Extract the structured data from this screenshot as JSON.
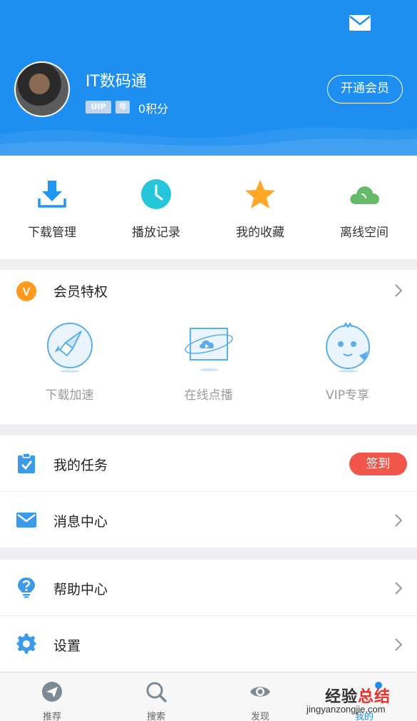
{
  "profile": {
    "username": "IT数码通",
    "badge_vip": "UIP",
    "badge_year": "年",
    "points": "0积分",
    "member_button": "开通会员"
  },
  "quick_actions": [
    {
      "label": "下载管理",
      "icon": "download-icon",
      "color": "#2196f3"
    },
    {
      "label": "播放记录",
      "icon": "clock-icon",
      "color": "#26c6da"
    },
    {
      "label": "我的收藏",
      "icon": "star-icon",
      "color": "#ffa726"
    },
    {
      "label": "离线空间",
      "icon": "cloud-icon",
      "color": "#66bb6a"
    }
  ],
  "vip_section": {
    "title": "会员特权",
    "badge_letter": "V",
    "perks": [
      {
        "label": "下载加速",
        "icon": "rocket-icon"
      },
      {
        "label": "在线点播",
        "icon": "video-play-icon"
      },
      {
        "label": "VIP专享",
        "icon": "mascot-icon"
      }
    ]
  },
  "menu_group_1": [
    {
      "label": "我的任务",
      "icon": "clipboard-check-icon",
      "action_label": "签到"
    },
    {
      "label": "消息中心",
      "icon": "envelope-icon"
    }
  ],
  "menu_group_2": [
    {
      "label": "帮助中心",
      "icon": "help-bulb-icon"
    },
    {
      "label": "设置",
      "icon": "gear-icon"
    }
  ],
  "tabbar": [
    {
      "label": "推荐",
      "icon": "paper-plane-icon",
      "active": false
    },
    {
      "label": "搜索",
      "icon": "search-icon",
      "active": false
    },
    {
      "label": "发现",
      "icon": "eye-icon",
      "active": false
    },
    {
      "label": "我的",
      "icon": "user-icon",
      "active": true
    }
  ],
  "watermark": {
    "text_a": "经验",
    "text_b": "总结",
    "url": "jingyanzongjie.com"
  },
  "colors": {
    "brand_blue": "#1e8ef0",
    "signin_red": "#f0564a",
    "vip_orange": "#ff9a1f"
  }
}
